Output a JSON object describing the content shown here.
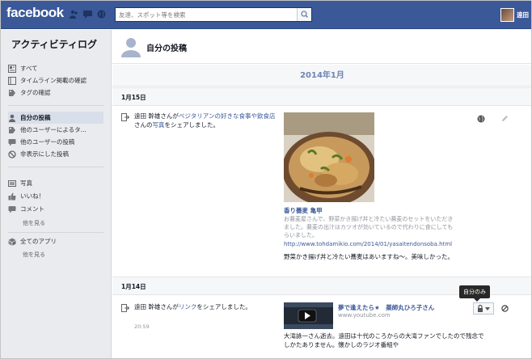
{
  "topbar": {
    "logo": "facebook",
    "search_placeholder": "友達、スポット等を検索",
    "user_name": "遠田 ",
    "brand_color": "#3b5998"
  },
  "sidebar": {
    "title": "アクティビティログ",
    "items": [
      {
        "label": "すべて",
        "icon": "news-icon"
      },
      {
        "label": "タイムライン掲載の確認",
        "icon": "timeline-icon"
      },
      {
        "label": "タグの確認",
        "icon": "tag-icon"
      },
      {
        "label": "自分の投稿",
        "icon": "person-icon",
        "active": true
      },
      {
        "label": "他のユーザーによるタ...",
        "icon": "tag-icon"
      },
      {
        "label": "他のユーザーの投稿",
        "icon": "comment-icon"
      },
      {
        "label": "非表示にした投稿",
        "icon": "hidden-icon"
      },
      {
        "label": "写真",
        "icon": "photo-icon"
      },
      {
        "label": "いいね！",
        "icon": "like-icon"
      },
      {
        "label": "コメント",
        "icon": "comment-icon"
      },
      {
        "label": "全てのアプリ",
        "icon": "apps-icon"
      }
    ],
    "more_labels": [
      "他を見る",
      "他を見る"
    ]
  },
  "main": {
    "title": "自分の投稿",
    "year": "2014年1月",
    "sections": [
      {
        "date": "1月15日",
        "story_parts": {
          "actor": "遠田 幹雄",
          "pre": "さんが",
          "link1": "ベジタリアンの好きな食事や飲食店",
          "mid": "さんの",
          "link2": "写真",
          "post": "をシェアしました。"
        },
        "attachment": {
          "title": "香り蕎麦 亀甲",
          "description": "お蕎麦屋さんで、野菜かき揚げ丼と冷たい蕎麦のセットをいただきました。蕎麦の出汁はカツオが効いているので代わりに食にしてもらいました。",
          "url": "http://www.tohdamikio.com/2014/01/yasaitendonsoba.html",
          "caption": "野菜かき揚げ丼と冷たい蕎麦はあいますね〜。美味しかった。"
        }
      },
      {
        "date": "1月14日",
        "story_parts": {
          "actor": "遠田 幹雄",
          "pre": "さんが",
          "link1": "リンク",
          "post": "をシェアしました。"
        },
        "time": "20:59",
        "video": {
          "title": "夢で逢えたら★　薬師丸ひろ子さん",
          "url": "www.youtube.com",
          "caption": "大滝詠一さん逝去。遠田は十代のころからの大滝ファンでしたので残念でしかたありません。懐かしのラジオ番組や"
        },
        "privacy_tooltip": "自分のみ"
      }
    ]
  }
}
